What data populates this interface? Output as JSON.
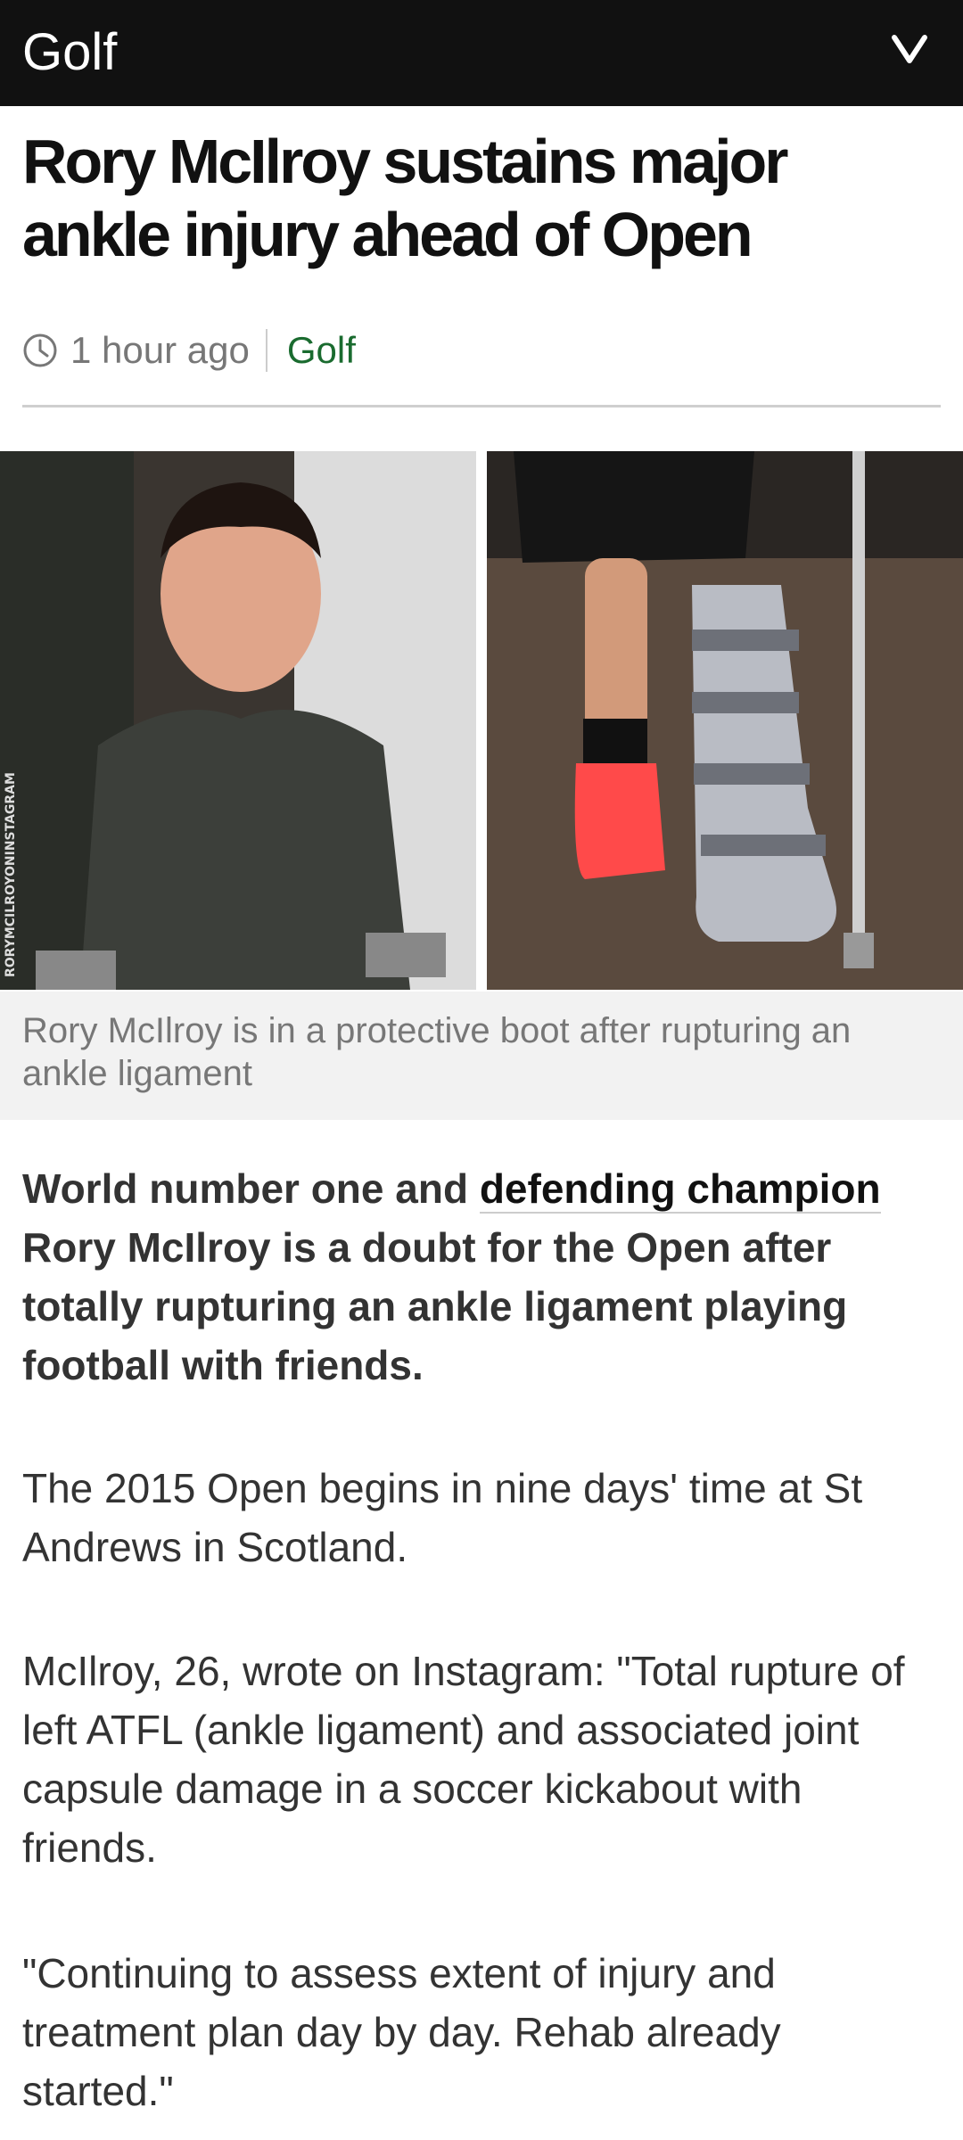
{
  "header": {
    "section": "Golf",
    "menu_icon": "chevron-down-icon"
  },
  "article": {
    "headline": "Rory McIlroy sustains major ankle injury ahead of Open",
    "time": "1 hour ago",
    "category": "Golf",
    "image_credit": "RORYMCILROYONINSTAGRAM",
    "caption": "Rory McIlroy is in a protective boot after rupturing an ankle ligament",
    "lead_before": "World number one and ",
    "lead_link": "defending champion",
    "lead_after": " Rory McIlroy is a doubt for the Open after totally rupturing an ankle ligament playing football with friends.",
    "paragraphs": [
      "The 2015 Open begins in nine days' time at St Andrews in Scotland.",
      "McIlroy, 26, wrote on Instagram: \"Total rupture of left ATFL (ankle ligament) and associated joint capsule damage in a soccer kickabout with friends.",
      "\"Continuing to assess extent of injury and treatment plan day by day. Rehab already started.\""
    ]
  },
  "colors": {
    "topbar": "#111111",
    "category": "#1a6b2f",
    "caption_bg": "#f2f2f2"
  }
}
